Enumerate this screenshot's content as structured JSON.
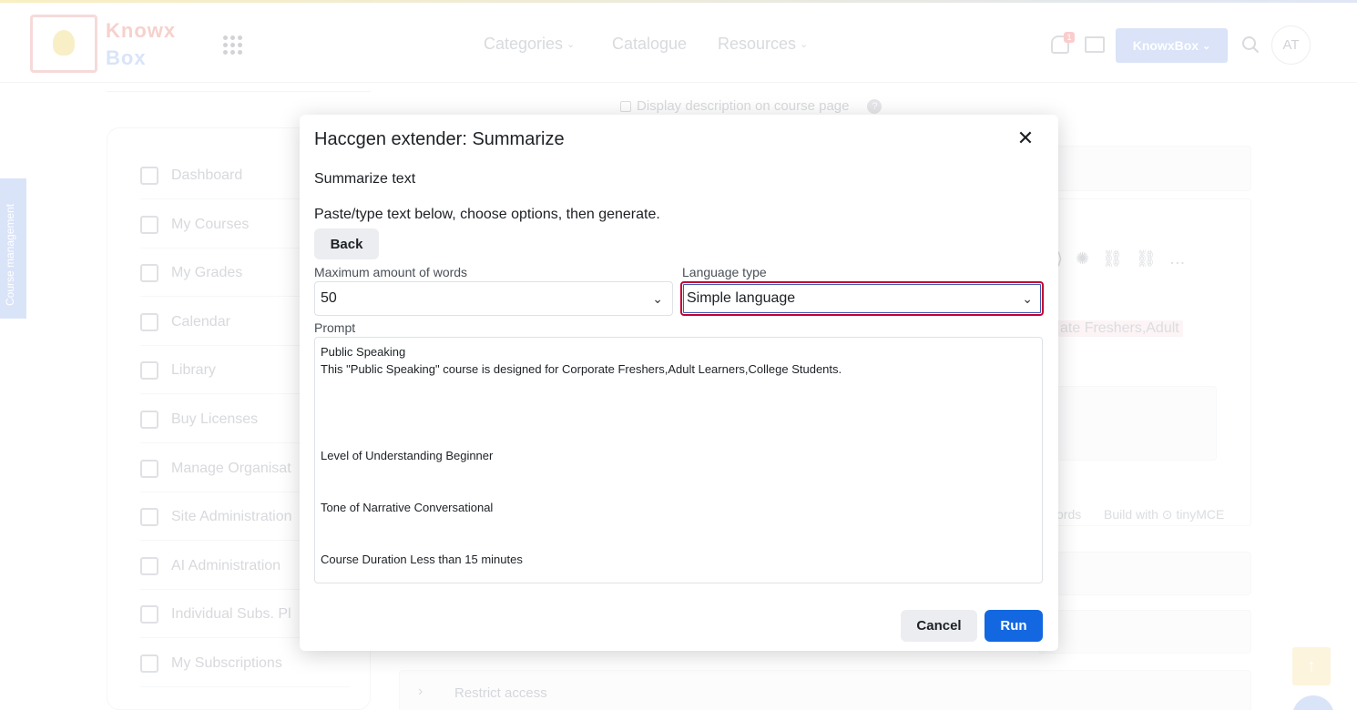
{
  "header": {
    "logo_line1": "Knowx",
    "logo_line2": "Box",
    "nav": [
      {
        "label": "Categories",
        "has_dropdown": true
      },
      {
        "label": "Catalogue",
        "has_dropdown": false
      },
      {
        "label": "Resources",
        "has_dropdown": true
      }
    ],
    "notification_count": "1",
    "user_menu_label": "KnowxBox",
    "avatar_initials": "AT"
  },
  "side_tab": {
    "label": "Course management"
  },
  "sidebar": {
    "items": [
      {
        "label": "Dashboard",
        "icon": "dashboard-icon"
      },
      {
        "label": "My Courses",
        "icon": "book-icon"
      },
      {
        "label": "My Grades",
        "icon": "grades-icon"
      },
      {
        "label": "Calendar",
        "icon": "calendar-icon"
      },
      {
        "label": "Library",
        "icon": "library-icon"
      },
      {
        "label": "Buy Licenses",
        "icon": "license-icon"
      },
      {
        "label": "Manage Organisat",
        "icon": "organisation-icon"
      },
      {
        "label": "Site Administration",
        "icon": "gear-icon"
      },
      {
        "label": "AI Administration",
        "icon": "sparkle-icon"
      },
      {
        "label": "Individual Subs. Pl",
        "icon": "users-icon"
      },
      {
        "label": "My Subscriptions",
        "icon": "tag-icon"
      }
    ]
  },
  "background": {
    "display_description_label": "Display description on course page",
    "editor_snippet": "ate Freshers,Adult",
    "editor_footer_words": "ords",
    "editor_footer_brand": "Build with ⊙ tinyMCE",
    "restrict_access": "Restrict access"
  },
  "modal": {
    "title": "Haccgen extender: Summarize",
    "subheading": "Summarize text",
    "instructions": "Paste/type text below, choose options, then generate.",
    "back_label": "Back",
    "max_words_label": "Maximum amount of words",
    "max_words_value": "50",
    "language_type_label": "Language type",
    "language_type_value": "Simple language",
    "prompt_label": "Prompt",
    "prompt_value": "Public Speaking\nThis \"Public Speaking\" course is designed for Corporate Freshers,Adult Learners,College Students.\n\n\n\n\nLevel of Understanding Beginner\n\n\nTone of Narrative Conversational\n\n\nCourse Duration Less than 15 minutes",
    "cancel_label": "Cancel",
    "run_label": "Run"
  },
  "colors": {
    "primary": "#1368e1",
    "focus_border": "#c40033",
    "secondary_button": "#ebedf0"
  }
}
